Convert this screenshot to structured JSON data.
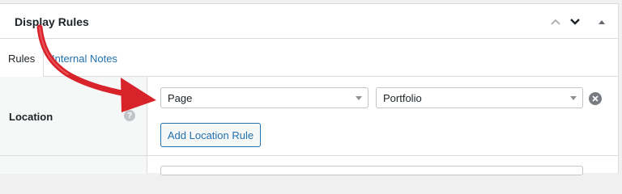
{
  "panel": {
    "title": "Display Rules",
    "controls": {
      "up_icon": "chevron-up-icon",
      "down_icon": "chevron-down-icon",
      "toggle_icon": "triangle-up-icon"
    }
  },
  "tabs": [
    {
      "label": "Rules",
      "active": true
    },
    {
      "label": "Internal Notes",
      "active": false
    }
  ],
  "location": {
    "label": "Location",
    "help_icon": "?",
    "rule": {
      "param_value": "Page",
      "value_value": "Portfolio"
    },
    "add_rule_label": "Add Location Rule"
  },
  "colors": {
    "accent": "#2271b1",
    "annotation_arrow": "#d9232a"
  }
}
